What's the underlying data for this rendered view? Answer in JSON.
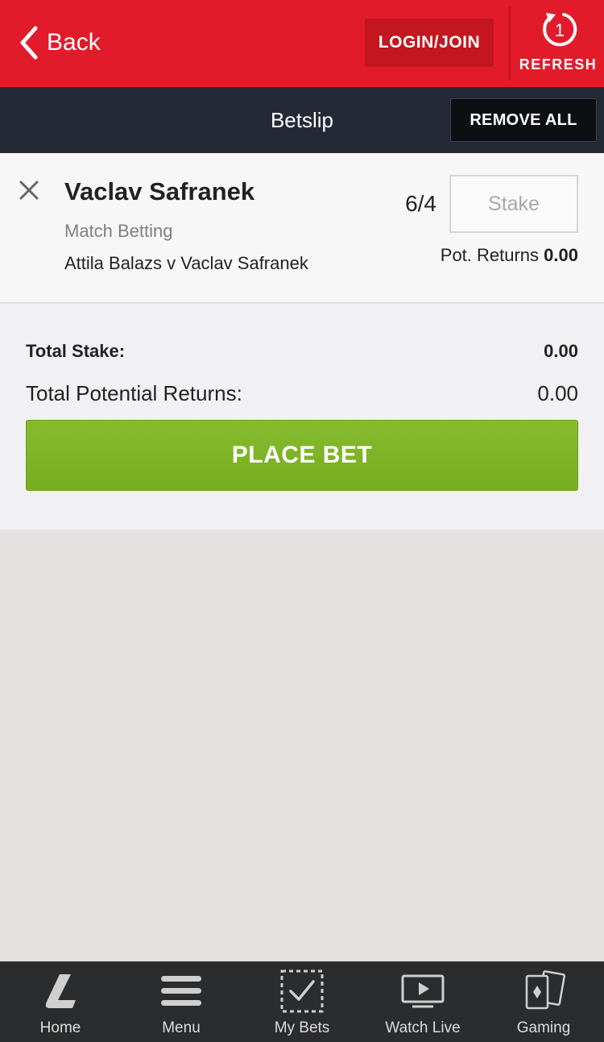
{
  "header": {
    "back_label": "Back",
    "login_label": "LOGIN/JOIN",
    "refresh_label": "REFRESH",
    "refresh_count": "1"
  },
  "titlebar": {
    "title": "Betslip",
    "remove_all_label": "REMOVE ALL"
  },
  "selection": {
    "name": "Vaclav Safranek",
    "market": "Match Betting",
    "event": "Attila Balazs v Vaclav Safranek",
    "odds": "6/4",
    "stake_placeholder": "Stake",
    "stake_value": "",
    "pot_returns_label": "Pot. Returns",
    "pot_returns_value": "0.00"
  },
  "totals": {
    "total_stake_label": "Total Stake:",
    "total_stake_value": "0.00",
    "total_returns_label": "Total Potential Returns:",
    "total_returns_value": "0.00",
    "place_bet_label": "PLACE BET"
  },
  "bottom_nav": [
    {
      "label": "Home",
      "icon": "home-logo-icon"
    },
    {
      "label": "Menu",
      "icon": "menu-icon"
    },
    {
      "label": "My Bets",
      "icon": "my-bets-icon"
    },
    {
      "label": "Watch Live",
      "icon": "watch-live-icon"
    },
    {
      "label": "Gaming",
      "icon": "gaming-cards-icon"
    }
  ],
  "colors": {
    "brand_red": "#e21b2b",
    "title_bar": "#232a35",
    "place_bet_green": "#7ab223",
    "nav_bg": "#2b2c2e"
  }
}
